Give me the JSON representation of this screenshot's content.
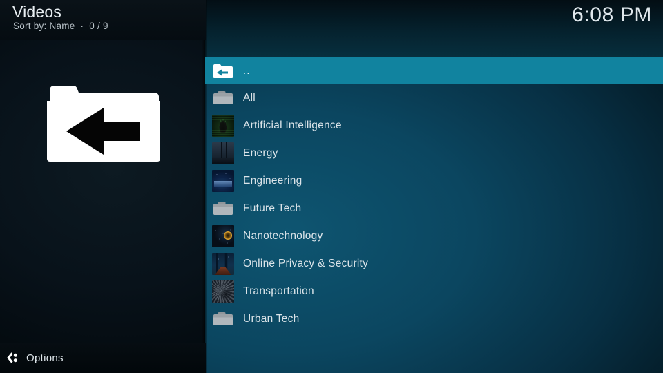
{
  "header": {
    "title": "Videos",
    "subtitle": "Sort by: Name  ·  0 / 9",
    "clock": "6:08 PM"
  },
  "hero": {
    "icon": "folder-back-icon"
  },
  "list": {
    "items": [
      {
        "label": "..",
        "icon": "folder-up-icon",
        "selected": true
      },
      {
        "label": "All",
        "icon": "folder-icon",
        "selected": false
      },
      {
        "label": "Artificial Intelligence",
        "icon": "thumbnail-ai",
        "selected": false
      },
      {
        "label": "Energy",
        "icon": "thumbnail-energy",
        "selected": false
      },
      {
        "label": "Engineering",
        "icon": "thumbnail-engineering",
        "selected": false
      },
      {
        "label": "Future Tech",
        "icon": "folder-icon",
        "selected": false
      },
      {
        "label": "Nanotechnology",
        "icon": "thumbnail-nanotechnology",
        "selected": false
      },
      {
        "label": "Online Privacy & Security",
        "icon": "thumbnail-online-privacy",
        "selected": false
      },
      {
        "label": "Transportation",
        "icon": "thumbnail-transportation",
        "selected": false
      },
      {
        "label": "Urban Tech",
        "icon": "folder-icon",
        "selected": false
      }
    ]
  },
  "footer": {
    "options_label": "Options",
    "options_icon": "left-nav-icon"
  },
  "colors": {
    "highlight": "#11839f",
    "background_right": "#0b4660",
    "background_left": "#08121a",
    "folder_gray": "#9aa1a6",
    "text_primary": "#dbe4e9"
  }
}
